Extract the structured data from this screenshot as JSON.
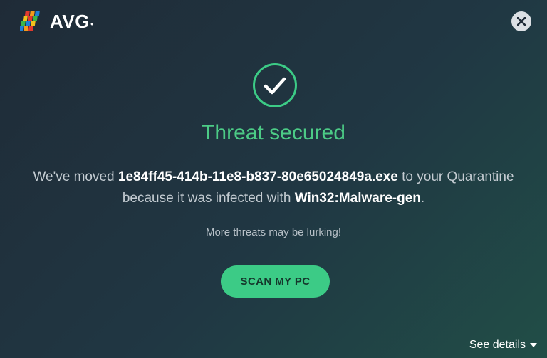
{
  "app": {
    "brand": "AVG"
  },
  "header": {
    "close_icon": "close-icon"
  },
  "status": {
    "icon": "check-icon",
    "title": "Threat secured",
    "msg_prefix": "We've moved ",
    "file_name": "1e84ff45-414b-11e8-b837-80e65024849a.exe",
    "msg_middle": " to your Quarantine because it was infected with ",
    "threat_name": "Win32:Malware-gen",
    "msg_suffix": ".",
    "subtext": "More threats may be lurking!"
  },
  "actions": {
    "scan_label": "SCAN MY PC"
  },
  "footer": {
    "details_label": "See details"
  },
  "colors": {
    "accent": "#3ccb86",
    "title": "#4ccb86"
  }
}
